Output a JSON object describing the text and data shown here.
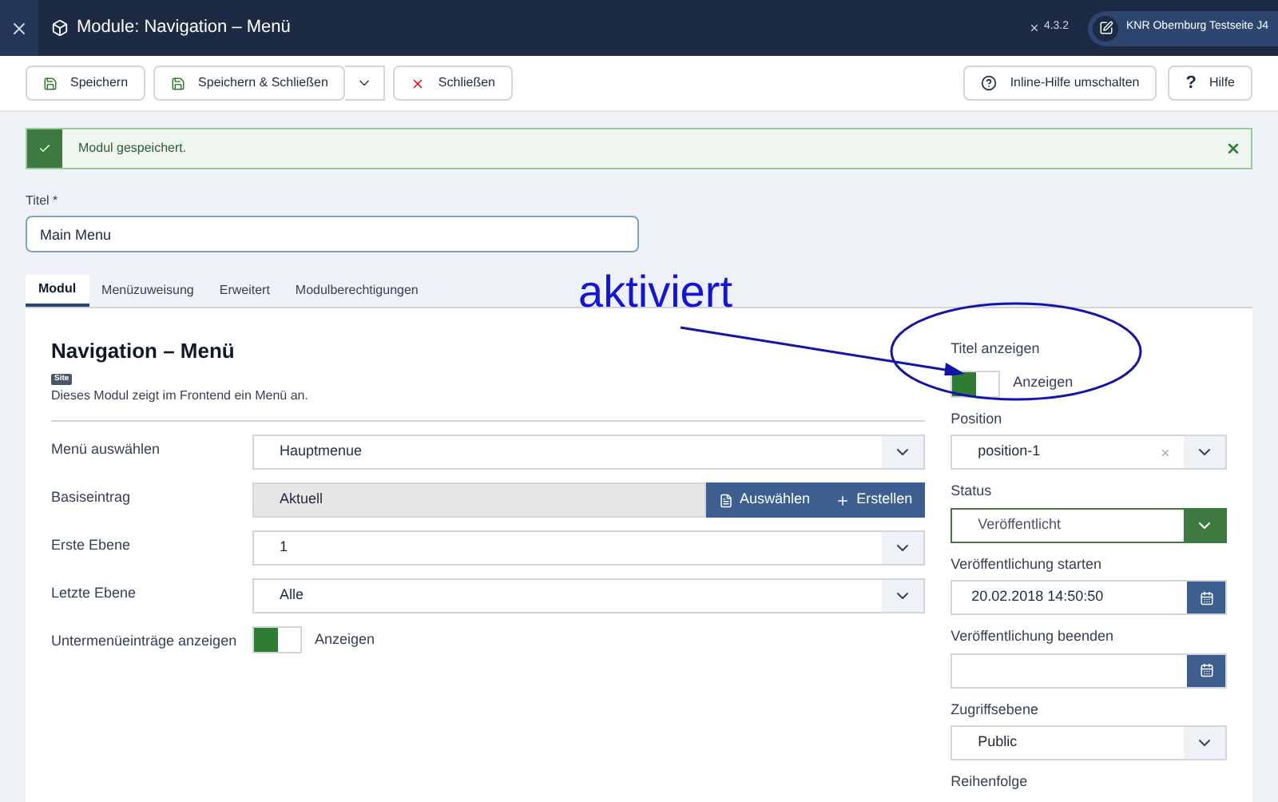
{
  "header": {
    "title": "Module: Navigation – Menü",
    "version": "4.3.2",
    "site_button": "KNR Obernburg Testseite J4"
  },
  "toolbar": {
    "left": [
      {
        "label": "Speichern",
        "kind": "save"
      },
      {
        "label": "Speichern & Schließen",
        "kind": "save-dropdown"
      },
      {
        "label": "Schließen",
        "kind": "close"
      }
    ],
    "right": [
      {
        "label": "Inline-Hilfe umschalten",
        "kind": "info"
      },
      {
        "label": "Hilfe",
        "kind": "help",
        "icon": "?"
      }
    ]
  },
  "alert": {
    "message": "Modul gespeichert."
  },
  "title_field": {
    "label": "Titel *",
    "value": "Main Menu"
  },
  "tabs": [
    {
      "label": "Modul",
      "selected": true
    },
    {
      "label": "Menüzuweisung",
      "selected": false
    },
    {
      "label": "Erweitert",
      "selected": false
    },
    {
      "label": "Modulberechtigungen",
      "selected": false
    }
  ],
  "module": {
    "heading": "Navigation – Menü",
    "badge": "Site",
    "description": "Dieses Modul zeigt im Frontend ein Menü an.",
    "fields": [
      {
        "kind": "select",
        "label": "Menü auswählen",
        "value": "Hauptmenue"
      },
      {
        "kind": "picker",
        "label": "Basiseintrag",
        "value": "Aktuell",
        "buttons": [
          "Auswählen",
          "Erstellen"
        ]
      },
      {
        "kind": "select",
        "label": "Erste Ebene",
        "value": "1"
      },
      {
        "kind": "select",
        "label": "Letzte Ebene",
        "value": "Alle"
      },
      {
        "kind": "toggle",
        "label": "Untermenüeinträge anzeigen",
        "on": true,
        "text": "Anzeigen"
      }
    ]
  },
  "sidebar": [
    {
      "kind": "toggle",
      "label": "Titel anzeigen",
      "on": true,
      "text": "Anzeigen"
    },
    {
      "kind": "select",
      "label": "Position",
      "value": "position-1",
      "clearable": true
    },
    {
      "kind": "status",
      "label": "Status",
      "value": "Veröffentlicht"
    },
    {
      "kind": "date",
      "label": "Veröffentlichung starten",
      "value": "20.02.2018 14:50:50"
    },
    {
      "kind": "date",
      "label": "Veröffentlichung beenden"
    },
    {
      "kind": "select",
      "label": "Zugriffsebene",
      "value": "Public"
    },
    {
      "kind": "label",
      "label": "Reihenfolge"
    }
  ],
  "annotation": {
    "text": "aktiviert"
  }
}
